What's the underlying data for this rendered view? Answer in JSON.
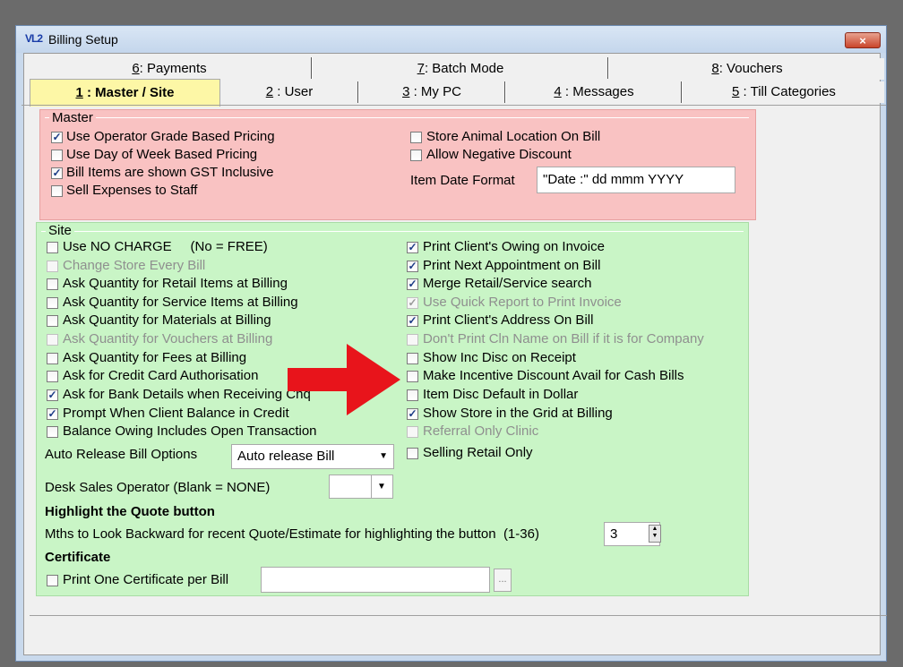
{
  "window": {
    "title": "Billing Setup",
    "icon_text": "VL2",
    "close_symbol": "×"
  },
  "tabs_row1": [
    {
      "key": "6",
      "label": ": Payments"
    },
    {
      "key": "7",
      "label": ": Batch Mode"
    },
    {
      "key": "8",
      "label": ": Vouchers"
    }
  ],
  "tabs_row2": [
    {
      "key": "1",
      "label": " : Master / Site",
      "active": true
    },
    {
      "key": "2",
      "label": " : User"
    },
    {
      "key": "3",
      "label": " : My PC"
    },
    {
      "key": "4",
      "label": " : Messages"
    },
    {
      "key": "5",
      "label": " : Till Categories"
    }
  ],
  "master": {
    "title": "Master",
    "items": [
      {
        "label": "Use Operator Grade Based Pricing",
        "checked": true
      },
      {
        "label": "Use Day of Week Based Pricing",
        "checked": false
      },
      {
        "label": "Bill Items are shown GST Inclusive",
        "checked": true
      },
      {
        "label": "Sell Expenses to Staff",
        "checked": false
      },
      {
        "label": "Store Animal Location On Bill",
        "checked": false
      },
      {
        "label": "Allow Negative Discount",
        "checked": false
      }
    ],
    "date_format_label": "Item Date Format",
    "date_format_value": "\"Date :\" dd mmm YYYY"
  },
  "site": {
    "title": "Site",
    "left": [
      {
        "label": "Use NO CHARGE     (No = FREE)",
        "checked": false,
        "disabled": false
      },
      {
        "label": "Change Store Every Bill",
        "checked": false,
        "disabled": true
      },
      {
        "label": "Ask Quantity for Retail Items at Billing",
        "checked": false,
        "disabled": false
      },
      {
        "label": "Ask Quantity for Service Items at Billing",
        "checked": false,
        "disabled": false
      },
      {
        "label": "Ask Quantity for Materials at Billing",
        "checked": false,
        "disabled": false
      },
      {
        "label": "Ask Quantity for Vouchers at Billing",
        "checked": false,
        "disabled": true
      },
      {
        "label": "Ask Quantity for Fees at Billing",
        "checked": false,
        "disabled": false
      },
      {
        "label": "Ask for Credit Card Authorisation",
        "checked": false,
        "disabled": false
      },
      {
        "label": "Ask for Bank Details when Receiving Chq",
        "checked": true,
        "disabled": false
      },
      {
        "label": "Prompt When Client Balance in Credit",
        "checked": true,
        "disabled": false
      },
      {
        "label": "Balance Owing Includes Open Transaction",
        "checked": false,
        "disabled": false
      }
    ],
    "right": [
      {
        "label": "Print Client's Owing on Invoice",
        "checked": true,
        "disabled": false
      },
      {
        "label": "Print Next Appointment on Bill",
        "checked": true,
        "disabled": false
      },
      {
        "label": "Merge Retail/Service search",
        "checked": true,
        "disabled": false
      },
      {
        "label": "Use Quick Report to Print Invoice",
        "checked": true,
        "disabled": true
      },
      {
        "label": "Print Client's Address On Bill",
        "checked": true,
        "disabled": false
      },
      {
        "label": "Don't Print Cln Name on Bill if it is for Company",
        "checked": false,
        "disabled": true
      },
      {
        "label": "Show Inc Disc on Receipt",
        "checked": false,
        "disabled": false
      },
      {
        "label": "Make Incentive Discount Avail for Cash Bills",
        "checked": false,
        "disabled": false
      },
      {
        "label": "Item Disc Default in Dollar",
        "checked": false,
        "disabled": false
      },
      {
        "label": "Show Store in the Grid at Billing",
        "checked": true,
        "disabled": false
      },
      {
        "label": "Referral Only Clinic",
        "checked": false,
        "disabled": true
      },
      {
        "label": "Selling Retail Only",
        "checked": false,
        "disabled": false
      }
    ],
    "auto_release_label": "Auto Release Bill Options",
    "auto_release_value": "Auto release Bill",
    "desk_sales_label": "Desk Sales Operator (Blank = NONE)",
    "desk_sales_value": "",
    "quote_heading": "Highlight the Quote button",
    "quote_label": "Mths to Look Backward for recent Quote/Estimate for highlighting the button  (1-36)",
    "quote_value": "3",
    "cert_heading": "Certificate",
    "cert_label": "Print One Certificate per Bill",
    "cert_value": "",
    "cert_button": "..."
  },
  "colors": {
    "master_bg": "#f9c2c2",
    "site_bg": "#c9f5c6",
    "active_tab": "#fdf7a6",
    "arrow": "#e8141b"
  }
}
